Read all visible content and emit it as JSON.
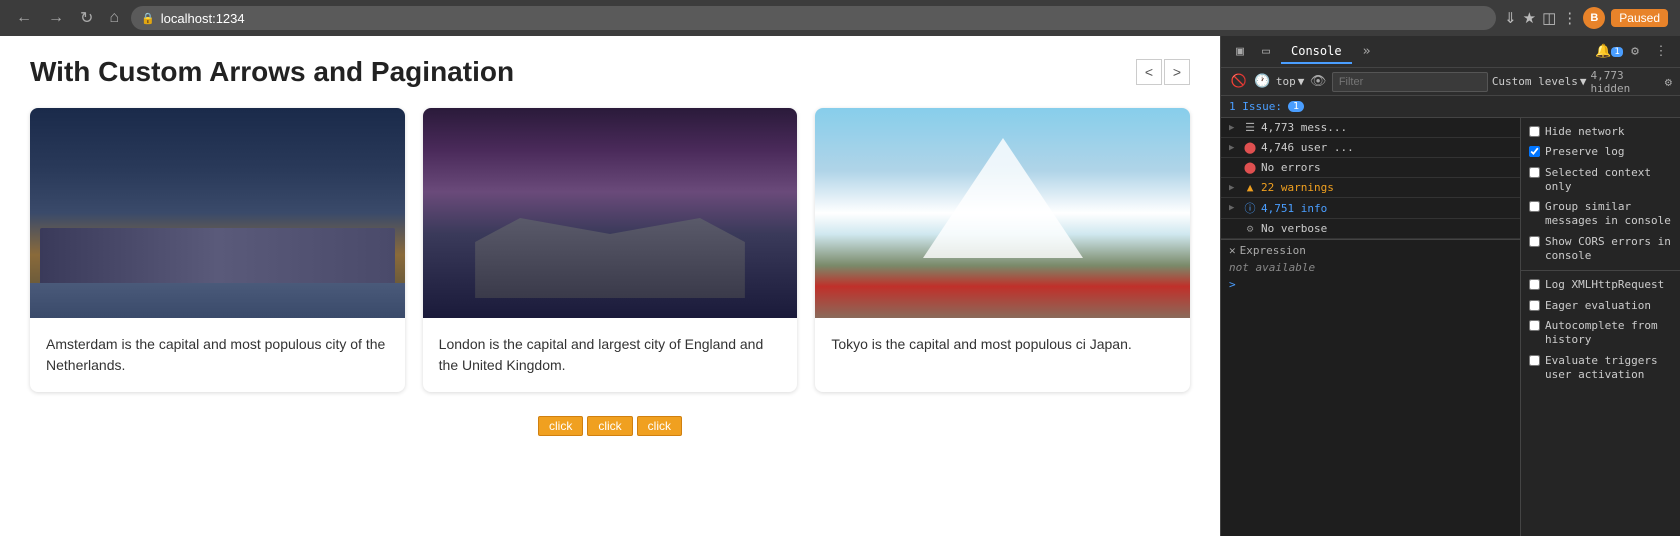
{
  "browser": {
    "url": "localhost:1234",
    "profile_initial": "B",
    "paused_label": "Paused"
  },
  "page": {
    "title": "With Custom Arrows and Pagination",
    "cards": [
      {
        "id": "amsterdam",
        "description": "Amsterdam is the capital and most populous city of the Netherlands."
      },
      {
        "id": "london",
        "description": "London is the capital and largest city of England and the United Kingdom."
      },
      {
        "id": "tokyo",
        "description": "Tokyo is the capital and most populous ci Japan."
      }
    ],
    "pagination_buttons": [
      "click",
      "click",
      "click"
    ]
  },
  "devtools": {
    "tab_label": "Console",
    "filter_placeholder": "Filter",
    "custom_levels_label": "Custom levels",
    "hidden_count": "4,773 hidden",
    "context_label": "top",
    "issues_label": "1 Issue:",
    "issues_badge": "1",
    "messages": [
      {
        "icon": "▶",
        "icon_type": "expand",
        "text": "4,773 mess...",
        "type": "normal"
      },
      {
        "icon": "▶",
        "icon_type": "expand",
        "text": "4,746 user ...",
        "type": "normal",
        "has_circle": true
      },
      {
        "icon": "●",
        "icon_type": "error",
        "text": "No errors",
        "type": "normal"
      },
      {
        "icon": "▲",
        "icon_type": "warn",
        "text": "22 warnings",
        "type": "warn"
      },
      {
        "icon": "ℹ",
        "icon_type": "info",
        "text": "4,751 info",
        "type": "info"
      },
      {
        "icon": "⚙",
        "icon_type": "verbose",
        "text": "No verbose",
        "type": "normal"
      }
    ],
    "settings": [
      {
        "id": "hide_network",
        "label": "Hide network",
        "checked": false
      },
      {
        "id": "preserve_log",
        "label": "Preserve log",
        "checked": true
      },
      {
        "id": "selected_context",
        "label": "Selected context only",
        "checked": false
      },
      {
        "id": "group_similar",
        "label": "Group similar messages in console",
        "checked": false
      },
      {
        "id": "show_cors",
        "label": "Show CORS errors in console",
        "checked": false
      }
    ],
    "right_settings": [
      {
        "id": "log_xml",
        "label": "Log XMLHttpRequest",
        "checked": false
      },
      {
        "id": "eager_eval",
        "label": "Eager evaluation",
        "checked": false
      },
      {
        "id": "autocomplete",
        "label": "Autocomplete from history",
        "checked": false
      },
      {
        "id": "evaluate_triggers",
        "label": "Evaluate triggers user activation",
        "checked": false
      }
    ],
    "expression_label": "Expression",
    "expression_value": "not available",
    "prompt_symbol": ">"
  }
}
